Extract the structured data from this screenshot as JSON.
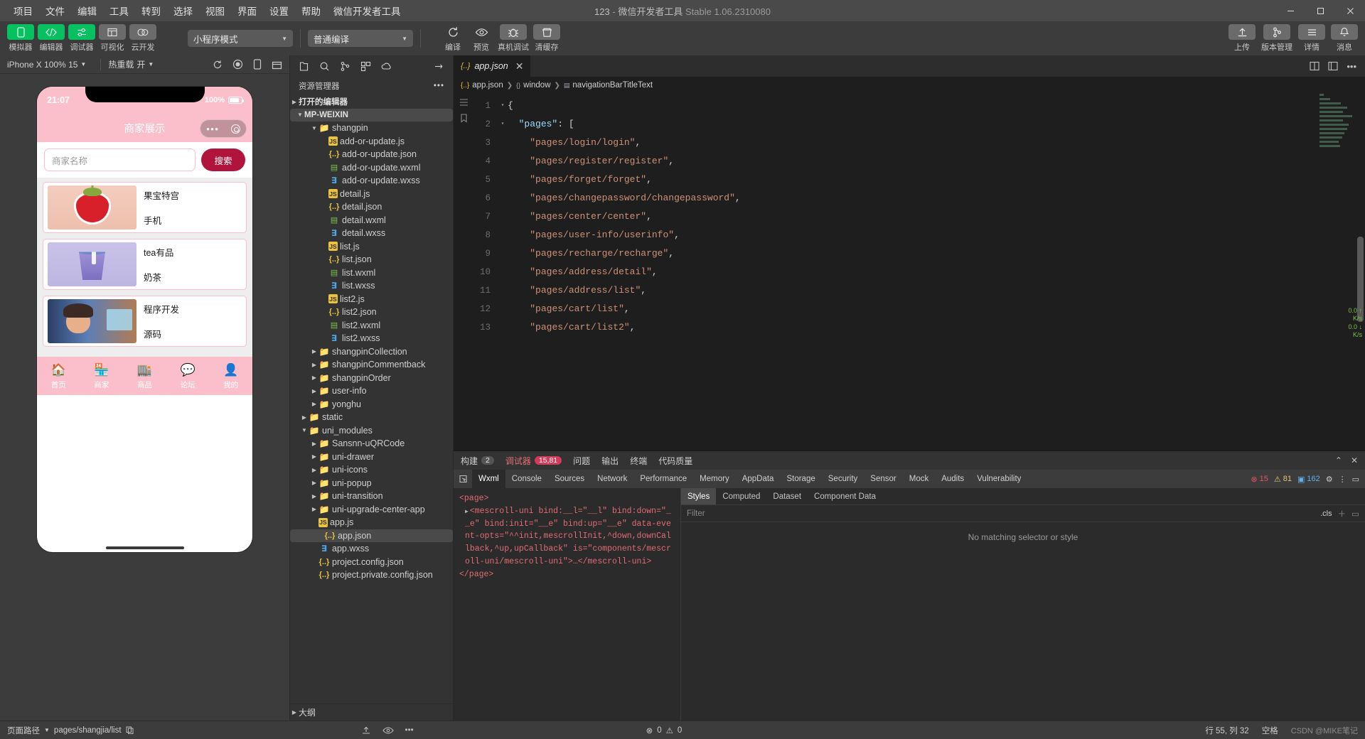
{
  "titlebar": {
    "menus": [
      "项目",
      "文件",
      "编辑",
      "工具",
      "转到",
      "选择",
      "视图",
      "界面",
      "设置",
      "帮助",
      "微信开发者工具"
    ],
    "project_name": "123",
    "dash": "-",
    "app_name": "微信开发者工具",
    "version": "Stable 1.06.2310080",
    "window_controls": {
      "minimize": "—",
      "maximize": "▢",
      "close": "✕"
    }
  },
  "toolbar": {
    "left_buttons": [
      {
        "label": "模拟器",
        "icon": "simulator-icon",
        "style": "green"
      },
      {
        "label": "编辑器",
        "icon": "code-icon",
        "style": "green"
      },
      {
        "label": "调试器",
        "icon": "debugger-icon",
        "style": "green"
      },
      {
        "label": "可视化",
        "icon": "layout-icon",
        "style": "grey"
      },
      {
        "label": "云开发",
        "icon": "cloud-icon",
        "style": "grey"
      }
    ],
    "mode_select": "小程序模式",
    "compile_select": "普通编译",
    "actions": [
      {
        "label": "编译",
        "icon": "refresh-icon"
      },
      {
        "label": "预览",
        "icon": "eye-icon"
      },
      {
        "label": "真机调试",
        "icon": "bug-icon"
      },
      {
        "label": "清缓存",
        "icon": "clear-cache-icon"
      }
    ],
    "right_buttons": [
      {
        "label": "上传",
        "icon": "upload-icon"
      },
      {
        "label": "版本管理",
        "icon": "branch-icon"
      },
      {
        "label": "详情",
        "icon": "menu-icon"
      },
      {
        "label": "消息",
        "icon": "bell-icon"
      }
    ]
  },
  "simulator": {
    "device_select": "iPhone X 100% 15",
    "hotreload_label": "热重载",
    "hotreload_value": "开",
    "phone": {
      "status_time": "21:07",
      "battery_text": "100%",
      "nav_title": "商家展示",
      "search_placeholder": "商家名称",
      "search_button": "搜索",
      "cards": [
        {
          "name": "果宝特宫",
          "category": "手机",
          "thumb": "strawberry-thumb"
        },
        {
          "name": "tea有品",
          "category": "奶茶",
          "thumb": "bubbletea-thumb"
        },
        {
          "name": "程序开发",
          "category": "源码",
          "thumb": "developer-thumb"
        }
      ],
      "tabbar": [
        {
          "label": "首页",
          "icon": "home-icon"
        },
        {
          "label": "商家",
          "icon": "shop-icon"
        },
        {
          "label": "商品",
          "icon": "store-icon"
        },
        {
          "label": "论坛",
          "icon": "forum-icon"
        },
        {
          "label": "我的",
          "icon": "user-icon"
        }
      ]
    }
  },
  "explorer": {
    "title": "资源管理器",
    "open_editors": "打开的编辑器",
    "project_root": "MP-WEIXIN",
    "outline": "大纲",
    "tree": [
      {
        "label": "shangpin",
        "type": "folder",
        "indent": 2,
        "open": true
      },
      {
        "label": "add-or-update.js",
        "type": "js",
        "indent": 3
      },
      {
        "label": "add-or-update.json",
        "type": "json",
        "indent": 3
      },
      {
        "label": "add-or-update.wxml",
        "type": "wxml",
        "indent": 3
      },
      {
        "label": "add-or-update.wxss",
        "type": "wxss",
        "indent": 3
      },
      {
        "label": "detail.js",
        "type": "js",
        "indent": 3
      },
      {
        "label": "detail.json",
        "type": "json",
        "indent": 3
      },
      {
        "label": "detail.wxml",
        "type": "wxml",
        "indent": 3
      },
      {
        "label": "detail.wxss",
        "type": "wxss",
        "indent": 3
      },
      {
        "label": "list.js",
        "type": "js",
        "indent": 3
      },
      {
        "label": "list.json",
        "type": "json",
        "indent": 3
      },
      {
        "label": "list.wxml",
        "type": "wxml",
        "indent": 3
      },
      {
        "label": "list.wxss",
        "type": "wxss",
        "indent": 3
      },
      {
        "label": "list2.js",
        "type": "js",
        "indent": 3
      },
      {
        "label": "list2.json",
        "type": "json",
        "indent": 3
      },
      {
        "label": "list2.wxml",
        "type": "wxml",
        "indent": 3
      },
      {
        "label": "list2.wxss",
        "type": "wxss",
        "indent": 3
      },
      {
        "label": "shangpinCollection",
        "type": "folder",
        "indent": 2,
        "open": false
      },
      {
        "label": "shangpinCommentback",
        "type": "folder",
        "indent": 2,
        "open": false
      },
      {
        "label": "shangpinOrder",
        "type": "folder",
        "indent": 2,
        "open": false
      },
      {
        "label": "user-info",
        "type": "folder",
        "indent": 2,
        "open": false
      },
      {
        "label": "yonghu",
        "type": "folder",
        "indent": 2,
        "open": false
      },
      {
        "label": "static",
        "type": "folder",
        "indent": 1,
        "open": false
      },
      {
        "label": "uni_modules",
        "type": "folder",
        "indent": 1,
        "open": true
      },
      {
        "label": "Sansnn-uQRCode",
        "type": "folder",
        "indent": 2,
        "open": false
      },
      {
        "label": "uni-drawer",
        "type": "folder",
        "indent": 2,
        "open": false
      },
      {
        "label": "uni-icons",
        "type": "folder",
        "indent": 2,
        "open": false
      },
      {
        "label": "uni-popup",
        "type": "folder",
        "indent": 2,
        "open": false
      },
      {
        "label": "uni-transition",
        "type": "folder",
        "indent": 2,
        "open": false
      },
      {
        "label": "uni-upgrade-center-app",
        "type": "folder",
        "indent": 2,
        "open": false
      },
      {
        "label": "app.js",
        "type": "js",
        "indent": 2
      },
      {
        "label": "app.json",
        "type": "json",
        "indent": 2,
        "selected": true
      },
      {
        "label": "app.wxss",
        "type": "wxss",
        "indent": 2
      },
      {
        "label": "project.config.json",
        "type": "json",
        "indent": 2
      },
      {
        "label": "project.private.config.json",
        "type": "json",
        "indent": 2
      }
    ]
  },
  "editor": {
    "tab_label": "app.json",
    "tab_icon": "json-icon",
    "breadcrumb": [
      "app.json",
      "window",
      "navigationBarTitleText"
    ],
    "lines": [
      {
        "no": "1",
        "fold": "▾",
        "text": "{"
      },
      {
        "no": "2",
        "fold": "▾",
        "text": "  \"pages\": ["
      },
      {
        "no": "3",
        "fold": "",
        "text": "    \"pages/login/login\","
      },
      {
        "no": "4",
        "fold": "",
        "text": "    \"pages/register/register\","
      },
      {
        "no": "5",
        "fold": "",
        "text": "    \"pages/forget/forget\","
      },
      {
        "no": "6",
        "fold": "",
        "text": "    \"pages/changepassword/changepassword\","
      },
      {
        "no": "7",
        "fold": "",
        "text": "    \"pages/center/center\","
      },
      {
        "no": "8",
        "fold": "",
        "text": "    \"pages/user-info/userinfo\","
      },
      {
        "no": "9",
        "fold": "",
        "text": "    \"pages/recharge/recharge\","
      },
      {
        "no": "10",
        "fold": "",
        "text": "    \"pages/address/detail\","
      },
      {
        "no": "11",
        "fold": "",
        "text": "    \"pages/address/list\","
      },
      {
        "no": "12",
        "fold": "",
        "text": "    \"pages/cart/list\","
      },
      {
        "no": "13",
        "fold": "",
        "text": "    \"pages/cart/list2\","
      }
    ],
    "net_up": "0.0",
    "net_up_unit": "K/s",
    "net_down": "0.0",
    "net_down_unit": "K/s"
  },
  "devtools": {
    "top_tabs": [
      {
        "label": "构建",
        "badge": "2"
      },
      {
        "label": "调试器",
        "badge": "15,81",
        "badge_style": "pink"
      },
      {
        "label": "问题",
        "badge": ""
      },
      {
        "label": "输出",
        "badge": ""
      },
      {
        "label": "终端",
        "badge": ""
      },
      {
        "label": "代码质量",
        "badge": ""
      }
    ],
    "panel_tabs": [
      "Wxml",
      "Console",
      "Sources",
      "Network",
      "Performance",
      "Memory",
      "AppData",
      "Storage",
      "Security",
      "Sensor",
      "Mock",
      "Audits",
      "Vulnerability"
    ],
    "active_panel_tab": "Wxml",
    "counters": {
      "errors": "15",
      "warnings": "81",
      "infos": "162"
    },
    "wxml_source": [
      {
        "indent": 0,
        "text": "<page>",
        "type": "tag",
        "arrow": false
      },
      {
        "indent": 1,
        "text": "<mescroll-uni bind:__l=\"__l\" bind:down=\"__e\" bind:init=\"__e\" bind:up=\"__e\" data-event-opts=\"^^init,mescrollInit,^down,downCallback,^up,upCallback\" is=\"components/mescroll-uni/mescroll-uni\">…</mescroll-uni>",
        "type": "tag",
        "arrow": true
      },
      {
        "indent": 0,
        "text": "</page>",
        "type": "tag",
        "arrow": false
      }
    ],
    "style_tabs": [
      "Styles",
      "Computed",
      "Dataset",
      "Component Data"
    ],
    "active_style_tab": "Styles",
    "filter_placeholder": "Filter",
    "cls_label": ".cls",
    "no_match": "No matching selector or style"
  },
  "statusbar": {
    "page_path_label": "页面路径",
    "page_path_value": "pages/shangjia/list",
    "errors": "0",
    "warnings": "0",
    "cursor": "行 55, 列 32",
    "encoding": "空格",
    "watermark": "CSDN @MIKE笔记"
  }
}
